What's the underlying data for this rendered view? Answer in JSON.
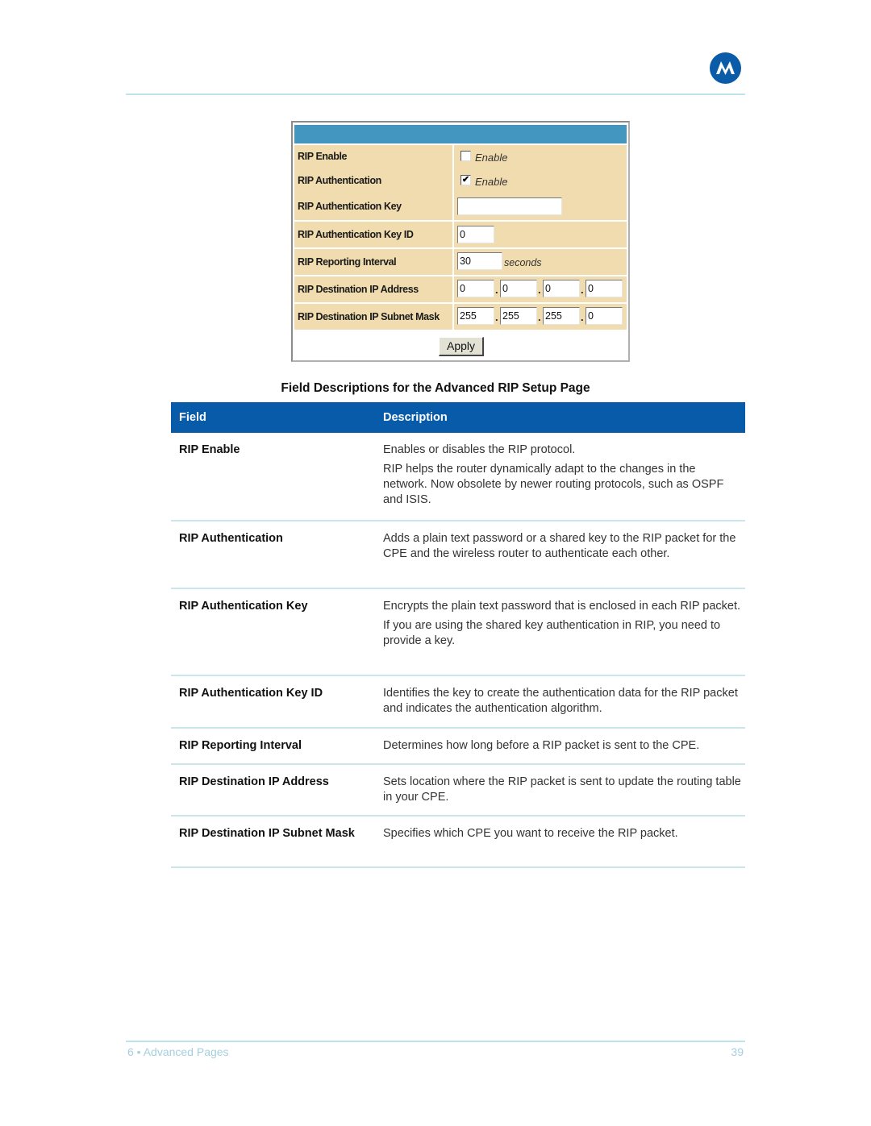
{
  "colors": {
    "brand_blue": "#0a5ba8",
    "table_header": "#075ba9",
    "panel_header": "#4396c0",
    "panel_row": "#f0dcae",
    "rule": "#bfe3ec",
    "footer_text": "#a6cfe0"
  },
  "logo": {
    "icon": "motorola-batwing-logo"
  },
  "form_panel": {
    "rows": [
      {
        "label": "RIP Enable",
        "type": "checkbox",
        "checked": false,
        "checkbox_label": "Enable"
      },
      {
        "label": "RIP Authentication",
        "type": "checkbox",
        "checked": true,
        "checkbox_label": "Enable"
      },
      {
        "label": "RIP Authentication Key",
        "type": "text",
        "value": ""
      },
      {
        "label": "RIP Authentication Key ID",
        "type": "text",
        "value": "0"
      },
      {
        "label": "RIP Reporting Interval",
        "type": "text",
        "value": "30",
        "unit": "seconds"
      },
      {
        "label": "RIP Destination IP Address",
        "type": "ip",
        "octets": [
          "0",
          "0",
          "0",
          "0"
        ]
      },
      {
        "label": "RIP Destination IP Subnet Mask",
        "type": "ip",
        "octets": [
          "255",
          "255",
          "255",
          "0"
        ]
      }
    ],
    "checkmark": "✔",
    "dot": ".",
    "apply_label": "Apply"
  },
  "table": {
    "title": "Field Descriptions for the Advanced RIP Setup Page",
    "headers": {
      "field": "Field",
      "description": "Description"
    },
    "rows": [
      {
        "field": "RIP Enable",
        "description": [
          "Enables or disables the RIP protocol.",
          "RIP helps the router dynamically adapt to the changes in the network. Now obsolete by newer routing protocols, such as OSPF and ISIS."
        ]
      },
      {
        "field": "RIP Authentication",
        "description": [
          "Adds a plain text password or a shared key to the RIP packet for the CPE and the wireless router to authenticate each other."
        ]
      },
      {
        "field": "RIP Authentication Key",
        "description": [
          "Encrypts the plain text password that is enclosed in each RIP packet.",
          "If you are using the shared key authentication in RIP, you need to provide a key."
        ]
      },
      {
        "field": "RIP Authentication Key ID",
        "description": [
          "Identifies the key to create the authentication data for the RIP packet and indicates the authentication algorithm."
        ]
      },
      {
        "field": "RIP Reporting Interval",
        "description": [
          "Determines how long before a RIP packet is sent to the CPE."
        ]
      },
      {
        "field": "RIP Destination IP Address",
        "description": [
          "Sets location where the RIP packet is sent to update the routing table in your CPE."
        ]
      },
      {
        "field": "RIP Destination IP Subnet Mask",
        "description": [
          "Specifies which CPE you want to receive the RIP packet."
        ]
      }
    ]
  },
  "footer": {
    "section": "6 • Advanced Pages",
    "page_number": "39"
  }
}
